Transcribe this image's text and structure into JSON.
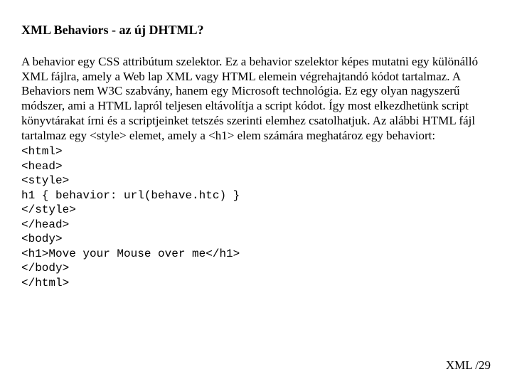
{
  "title": "XML Behaviors - az új DHTML?",
  "paragraph": "A behavior egy CSS attribútum szelektor. Ez a behavior szelektor képes mutatni egy különálló XML fájlra, amely a Web lap XML vagy HTML elemein végrehajtandó kódot tartalmaz.\nA Behaviors nem W3C szabvány, hanem egy Microsoft technológia.\nEz egy olyan nagyszerű módszer, ami a HTML lapról teljesen eltávolítja a script kódot. Így most elkezdhetünk script könyvtárakat írni és a scriptjeinket tetszés szerinti elemhez csatolhatjuk. Az alábbi HTML fájl tartalmaz egy <style> elemet, amely a <h1> elem számára meghatároz egy behaviort:",
  "code": "<html>\n<head>\n<style>\nh1 { behavior: url(behave.htc) }\n</style>\n</head>\n<body>\n<h1>Move your Mouse over me</h1>\n</body>\n</html>",
  "footer": "XML /29"
}
